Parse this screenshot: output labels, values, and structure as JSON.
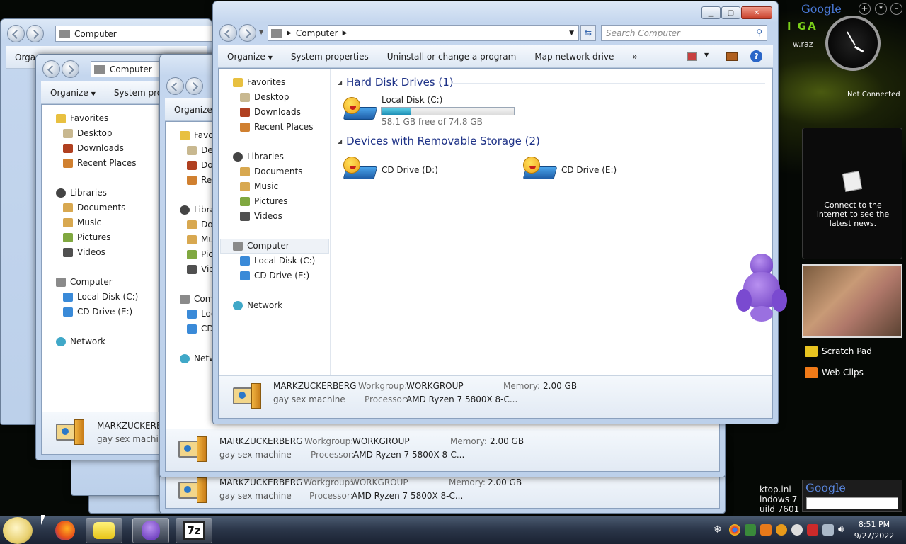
{
  "main_window": {
    "address": "Computer",
    "search_placeholder": "Search Computer",
    "toolbar": {
      "organize": "Organize",
      "system_properties": "System properties",
      "uninstall": "Uninstall or change a program",
      "map_drive": "Map network drive",
      "more": "»"
    },
    "nav": {
      "favorites": "Favorites",
      "desktop": "Desktop",
      "downloads": "Downloads",
      "recent": "Recent Places",
      "libraries": "Libraries",
      "documents": "Documents",
      "music": "Music",
      "pictures": "Pictures",
      "videos": "Videos",
      "computer": "Computer",
      "local_disk": "Local Disk (C:)",
      "cd_drive": "CD Drive (E:)",
      "network": "Network"
    },
    "groups": {
      "hdd_header": "Hard Disk Drives (1)",
      "removable_header": "Devices with Removable Storage (2)"
    },
    "drives": {
      "c_name": "Local Disk (C:)",
      "c_free": "58.1 GB free of 74.8 GB",
      "c_used_fraction": 0.22,
      "d_name": "CD Drive (D:)",
      "e_name": "CD Drive (E:)"
    },
    "details": {
      "pc_name": "MARKZUCKERBERG",
      "description": "gay sex machine",
      "workgroup_label": "Workgroup:",
      "workgroup": "WORKGROUP",
      "memory_label": "Memory:",
      "memory": "2.00 GB",
      "processor_label": "Processor:",
      "processor": "AMD Ryzen 7 5800X 8-C..."
    }
  },
  "bg_window": {
    "address": "Computer",
    "organize": "Organize",
    "system_prop_partial": "System prop",
    "libraries_partial": "Libra",
    "favorites_partial": "Favo",
    "desktop_partial": "Des",
    "downloads_partial": "Do",
    "recent_partial": "Rec",
    "documents_partial": "Do",
    "music_partial": "Mu",
    "pictures_partial": "Pic",
    "videos_partial": "Vid",
    "computer_partial": "Com",
    "local_partial": "Loc",
    "cd_partial": "CD",
    "network_partial": "Netw",
    "pc_name_partial": "MARKZUCKERE",
    "pc_name_partial2": "MARK",
    "description_partial": "gay sex machine",
    "description_partial2": "gay sex",
    "org_partial": "Orga",
    "g_partial": "gay s"
  },
  "gadgets": {
    "google_top": "Google",
    "not_connected": "Not Connected",
    "news_text": "Connect to the internet to see the latest news.",
    "scratch_pad": "Scratch Pad",
    "web_clips": "Web Clips",
    "google_bottom": "Google",
    "razer_partial": "I GA",
    "razer_partial2": "w.raz",
    "desktop_ini_1": "ktop.ini",
    "desktop_ini_2": "indows 7",
    "desktop_ini_3": "uild 7601"
  },
  "taskbar": {
    "time": "8:51 PM",
    "date": "9/27/2022",
    "sevenzip": "7z"
  }
}
